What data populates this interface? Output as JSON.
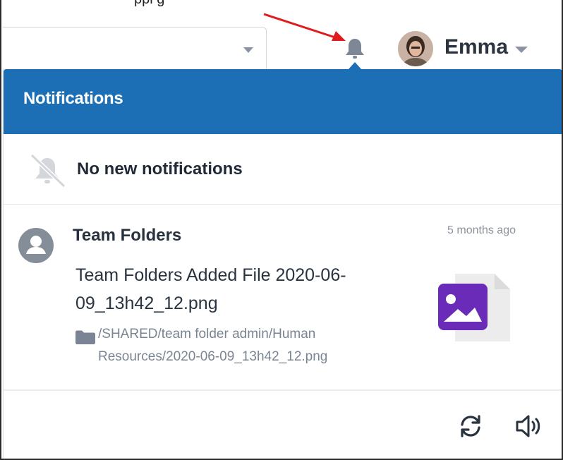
{
  "top_caption": "ppi g",
  "header": {
    "user_name": "Emma"
  },
  "notifications": {
    "title": "Notifications",
    "empty_message": "No new notifications",
    "items": [
      {
        "title": "Team Folders",
        "time": "5 months ago",
        "message": "Team Folders Added File 2020-06-09_13h42_12.png",
        "path": "/SHARED/team folder admin/Human Resources/2020-06-09_13h42_12.png",
        "thumbnail": "image-file-icon"
      }
    ]
  },
  "colors": {
    "header_blue": "#1c6eb5",
    "annotation_red": "#e01b1b",
    "thumbnail_purple": "#6a2bb8"
  },
  "icons": {
    "bell": "bell-icon",
    "bell_off": "bell-off-icon",
    "user": "user-circle-icon",
    "folder": "folder-icon",
    "refresh": "refresh-icon",
    "speaker": "speaker-icon"
  }
}
